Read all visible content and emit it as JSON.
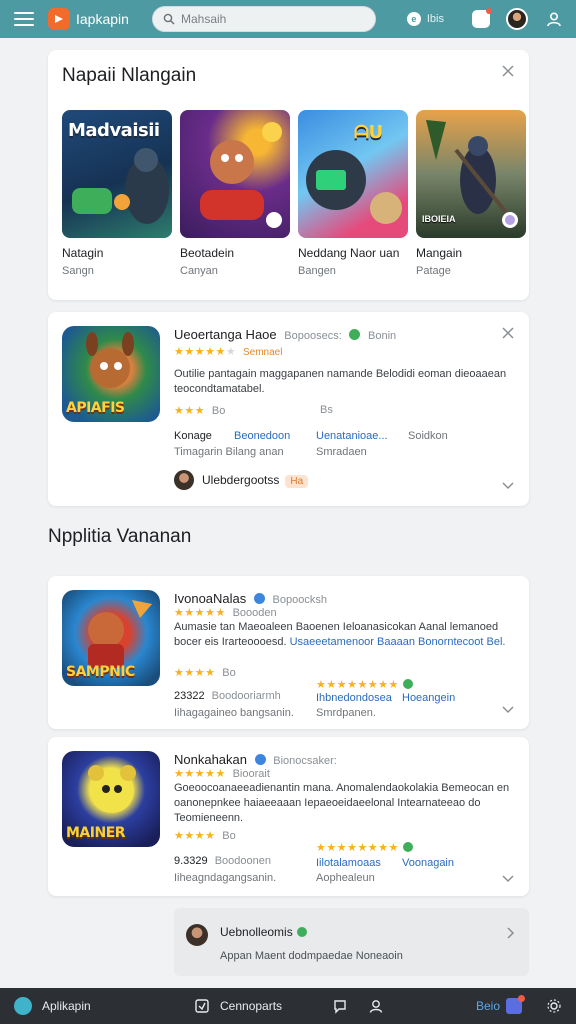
{
  "topbar": {
    "app_name": "Iapkapin",
    "search_placeholder": "Mahsaih",
    "lang_badge": "e",
    "lang_text": "Ibis"
  },
  "featured": {
    "title": "Napaii Nlangain",
    "tiles": [
      {
        "art_title": "Madvaisii",
        "name": "Natagin",
        "sub": "Sangn"
      },
      {
        "art_title": "",
        "name": "Beotadein",
        "sub": "Canyan"
      },
      {
        "art_title": "ᗩU",
        "name": "Neddang Naor uan",
        "sub": "Bangen"
      },
      {
        "art_title": "",
        "tag": "IBOIEIA",
        "name": "Mangain",
        "sub": "Patage"
      }
    ]
  },
  "app1": {
    "title": "Ueoertanga Haoe",
    "meta1": "Bopoosecs:",
    "meta2": "Bonin",
    "rating_meta": "Semnael",
    "desc": "Outilie pantagain maggapanen namande Belodidi eoman dieoaaean teocondtamatabel.",
    "stars_meta": "Bo",
    "chip_meta": "Bs",
    "col1_a": "Konage",
    "col1_b": "Timagarin Bilang anan",
    "col2_a": "Beonedoon",
    "col3_a": "Uenatanioae...",
    "col3_b": "Smradaen",
    "col4_a": "Soidkon",
    "author": "Ulebdergootss",
    "author_chip": "Ha"
  },
  "section_title": "Npplitia Vananan",
  "app2": {
    "title": "IvonoaNalas",
    "meta1": "Bopoocksh",
    "rating_meta": "Boooden",
    "desc_a": "Aumasie tan Maeoaleen Baoenen Ieloanasicokan Aanal lemanoed bocer eis Irarteoooesd.",
    "desc_link": "Usaeeetamenoor Baaaan Bonorntecoot Bel.",
    "stars_meta": "Bo",
    "num": "23322",
    "num_meta": "Boodooriarmh",
    "col_b": "Iihagagaineo bangsanin.",
    "col2_a": "Ihbnedondosea",
    "col2_b": "Smrdpanen.",
    "col3_a": "Hoeangein"
  },
  "app3": {
    "title": "Nonkahakan",
    "meta1": "Bionocsaker:",
    "rating_meta": "Bioorait",
    "desc": "Goeoocoanaeeadienantin mana. Anomalendaokolakia Bemeocan en oanonepnkee haiaeeaaan Iepaeoeidaeelonal Intearnateeao do Teomieneenn.",
    "stars_meta": "Bo",
    "num": "9.3329",
    "num_meta": "Boodoonen",
    "col_b": "Iiheagndagangsanin.",
    "col2_a": "Iilotalamoaas",
    "col2_b": "Aophealeun",
    "col3_a": "Voonagain"
  },
  "comment": {
    "name": "Uebnolleomis",
    "text": "Appan Maent dodmpaedae Noneaoin"
  },
  "bottombar": {
    "app": "Aplikapin",
    "compare": "Cennoparts",
    "right_label": "Beio"
  }
}
